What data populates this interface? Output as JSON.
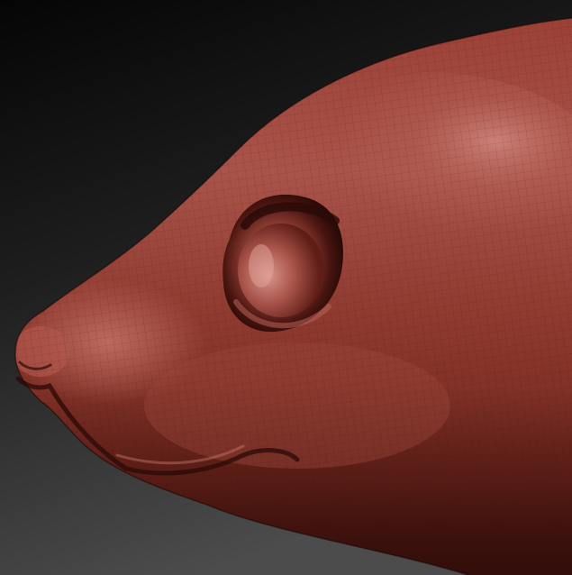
{
  "scene": {
    "subject": "sculpted-head-side-view",
    "colors": {
      "background_top": "#050505",
      "background_mid": "#2a2a2a",
      "background_bottom": "#4a4a4a",
      "clay_base": "#8a3328",
      "clay_light": "#b8655a",
      "clay_highlight": "#d9918a",
      "clay_shadow": "#4a1510",
      "clay_deep": "#2a0a07",
      "wire": "#3a0f0a"
    }
  }
}
